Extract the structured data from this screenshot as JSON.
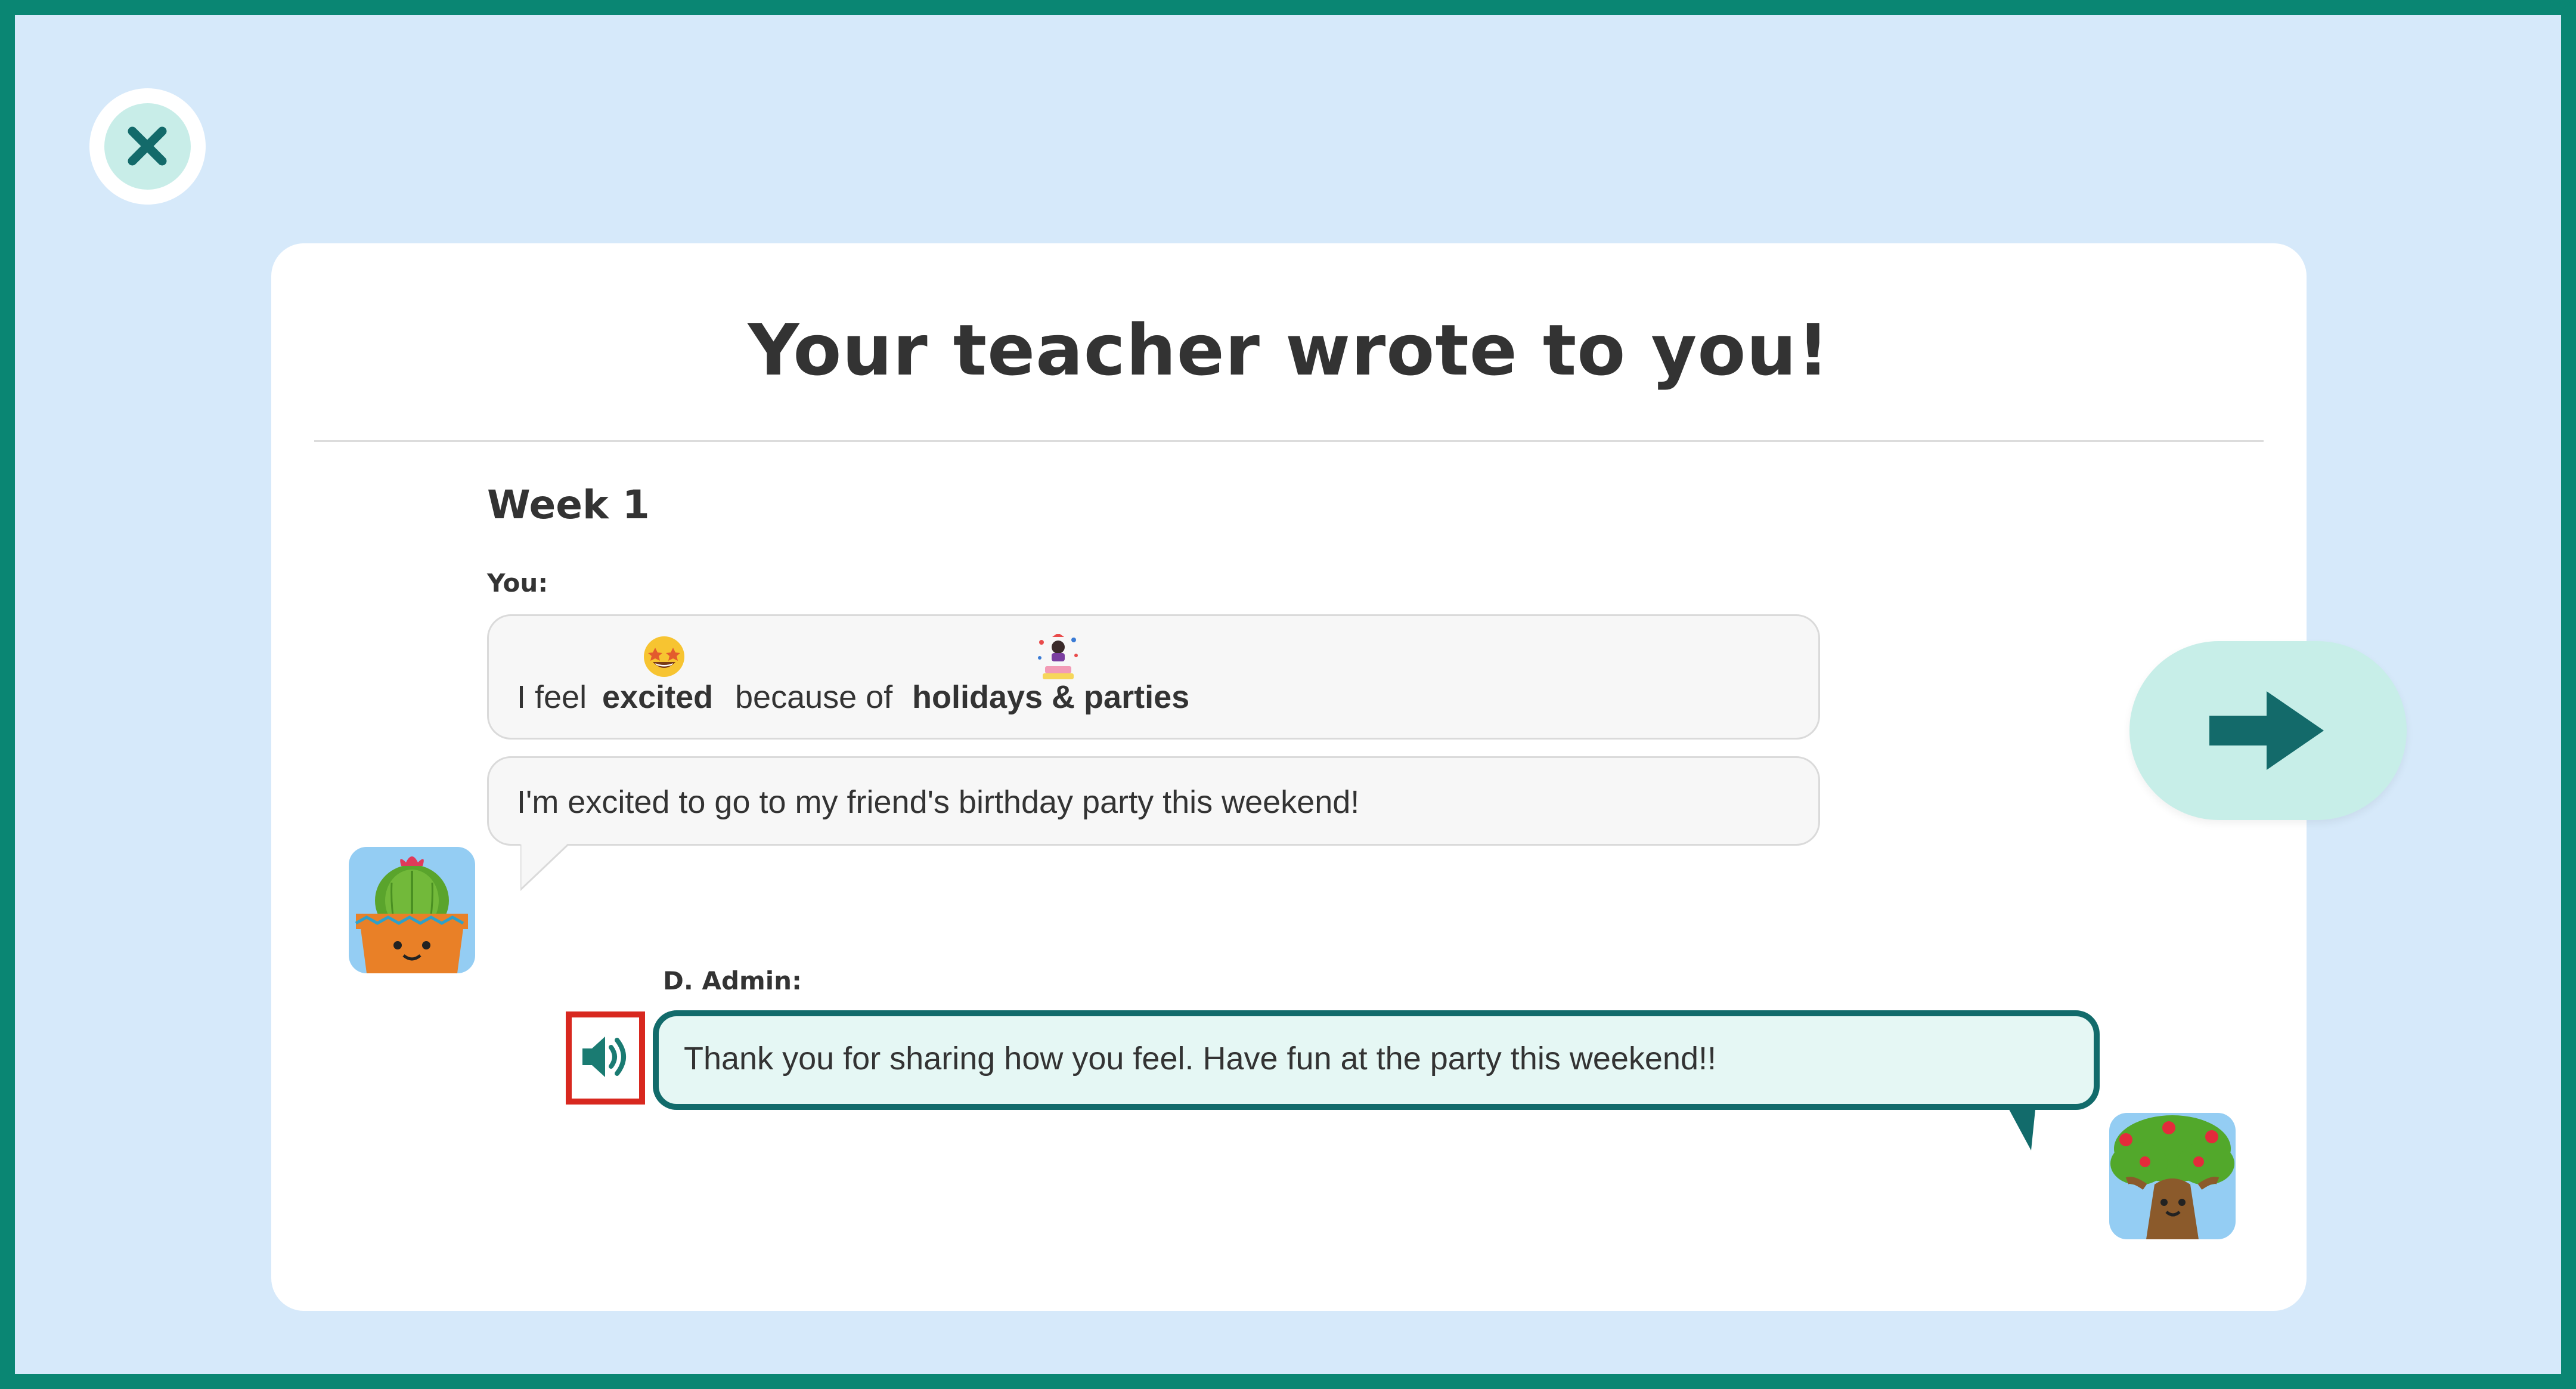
{
  "dialog": {
    "title": "Your teacher wrote to you!",
    "close_icon": "close-icon",
    "next_icon": "arrow-right-icon"
  },
  "week": {
    "label": "Week 1"
  },
  "student": {
    "author_label": "You:",
    "avatar": "cactus-avatar",
    "feeling": {
      "prefix": "I feel",
      "feeling_word": "excited",
      "feeling_icon": "star-eyes-emoji",
      "connector": "because of",
      "reason": "holidays & parties",
      "reason_icon": "party-emoji"
    },
    "message": "I'm excited to go to my friend's birthday party this weekend!"
  },
  "teacher": {
    "author_label": "D. Admin:",
    "avatar": "tree-avatar",
    "speaker_icon": "speaker-icon",
    "message": "Thank you for sharing how you feel. Have fun at the party this weekend!!"
  },
  "colors": {
    "border": "#0a8673",
    "background": "#d6e9fa",
    "teal_dark": "#126b6b",
    "teal_light": "#c7eee8",
    "highlight": "#d8281f"
  }
}
